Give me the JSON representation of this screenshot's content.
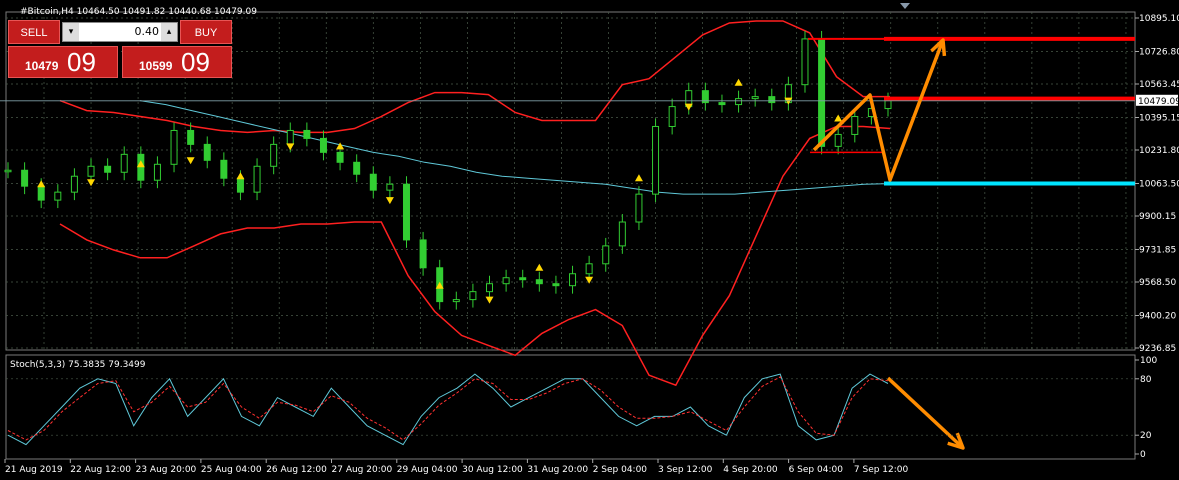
{
  "header": {
    "symbol_line": "#Bitcoin,H4  10464.50 10491.82 10440.68 10479.09",
    "stoch_label": "Stoch(5,3,3) 75.3835 79.3499"
  },
  "trade_panel": {
    "sell_label": "SELL",
    "buy_label": "BUY",
    "lot": "0.40",
    "bid_main": "10479",
    "bid_big": "09",
    "ask_main": "10599",
    "ask_big": "09"
  },
  "colors": {
    "background": "#000000",
    "grid": "#4a5a4a",
    "candle": "#32cd32",
    "bollinger": "#ff2020",
    "ma": "#5fc8d8",
    "stoch_main": "#5fc8d8",
    "stoch_signal": "#ff3030",
    "arrow": "#ff8c00",
    "fractal": "#ffd700",
    "resistance": "#ff0000",
    "support": "#00e5ff"
  },
  "chart_data": {
    "type": "candlestick",
    "price_axis": {
      "ticks": [
        "10895.10",
        "10726.80",
        "10563.45",
        "10395.15",
        "10231.80",
        "10063.50",
        "9900.15",
        "9731.85",
        "9568.50",
        "9400.20",
        "9236.85"
      ],
      "values": [
        10895.1,
        10726.8,
        10563.45,
        10395.15,
        10231.8,
        10063.5,
        9900.15,
        9731.85,
        9568.5,
        9400.2,
        9236.85
      ],
      "last_price": "10479.09"
    },
    "time_axis": [
      "21 Aug 2019",
      "22 Aug 12:00",
      "23 Aug 20:00",
      "25 Aug 04:00",
      "26 Aug 12:00",
      "27 Aug 20:00",
      "29 Aug 04:00",
      "30 Aug 12:00",
      "31 Aug 20:00",
      "2 Sep 04:00",
      "3 Sep 12:00",
      "4 Sep 20:00",
      "6 Sep 04:00",
      "7 Sep 12:00"
    ],
    "close_series": [
      10130,
      10050,
      9980,
      10020,
      10100,
      10150,
      10120,
      10210,
      10080,
      10160,
      10330,
      10260,
      10180,
      10090,
      10020,
      10150,
      10260,
      10330,
      10290,
      10220,
      10170,
      10110,
      10030,
      10060,
      9780,
      9640,
      9470,
      9480,
      9520,
      9560,
      9590,
      9580,
      9560,
      9550,
      9610,
      9660,
      9750,
      9870,
      10010,
      10350,
      10450,
      10530,
      10470,
      10460,
      10490,
      10500,
      10470,
      10560,
      10790,
      10250,
      10310,
      10400,
      10440,
      10480
    ],
    "upper_band": [
      10480,
      10430,
      10420,
      10400,
      10380,
      10350,
      10330,
      10320,
      10330,
      10320,
      10320,
      10340,
      10400,
      10470,
      10520,
      10520,
      10510,
      10420,
      10380,
      10380,
      10380,
      10560,
      10590,
      10700,
      10810,
      10870,
      10880,
      10880,
      10820,
      10600,
      10500,
      10500
    ],
    "lower_band": [
      9860,
      9780,
      9730,
      9690,
      9690,
      9750,
      9810,
      9840,
      9840,
      9860,
      9860,
      9870,
      9870,
      9600,
      9420,
      9300,
      9250,
      9200,
      9310,
      9380,
      9430,
      9350,
      9100,
      9050,
      9300,
      9500,
      9800,
      10100,
      10290,
      10350,
      10350,
      10340
    ],
    "ma_series": [
      10480,
      10460,
      10430,
      10400,
      10370,
      10340,
      10310,
      10280,
      10250,
      10220,
      10200,
      10170,
      10150,
      10120,
      10100,
      10090,
      10080,
      10070,
      10060,
      10040,
      10020,
      10010,
      10010,
      10010,
      10020,
      10030,
      10040,
      10050,
      10060,
      10063
    ],
    "stochastic": {
      "levels": [
        "100",
        "80",
        "20",
        "0"
      ],
      "main": [
        20,
        10,
        30,
        50,
        70,
        80,
        75,
        30,
        60,
        80,
        40,
        60,
        80,
        40,
        30,
        60,
        50,
        40,
        70,
        50,
        30,
        20,
        10,
        40,
        60,
        70,
        85,
        70,
        50,
        60,
        70,
        80,
        80,
        60,
        40,
        30,
        40,
        40,
        50,
        30,
        20,
        60,
        80,
        85,
        30,
        15,
        20,
        70,
        85,
        75
      ],
      "signal": [
        25,
        15,
        25,
        45,
        60,
        75,
        78,
        45,
        55,
        72,
        50,
        55,
        75,
        50,
        38,
        55,
        52,
        45,
        62,
        55,
        38,
        28,
        15,
        32,
        52,
        65,
        80,
        75,
        58,
        58,
        65,
        75,
        80,
        68,
        50,
        38,
        38,
        40,
        45,
        35,
        25,
        50,
        72,
        82,
        45,
        22,
        20,
        60,
        80,
        78
      ]
    },
    "annotations": {
      "resistance_level": 10790,
      "mid_level": 10490,
      "support_level": 10063.5
    }
  }
}
